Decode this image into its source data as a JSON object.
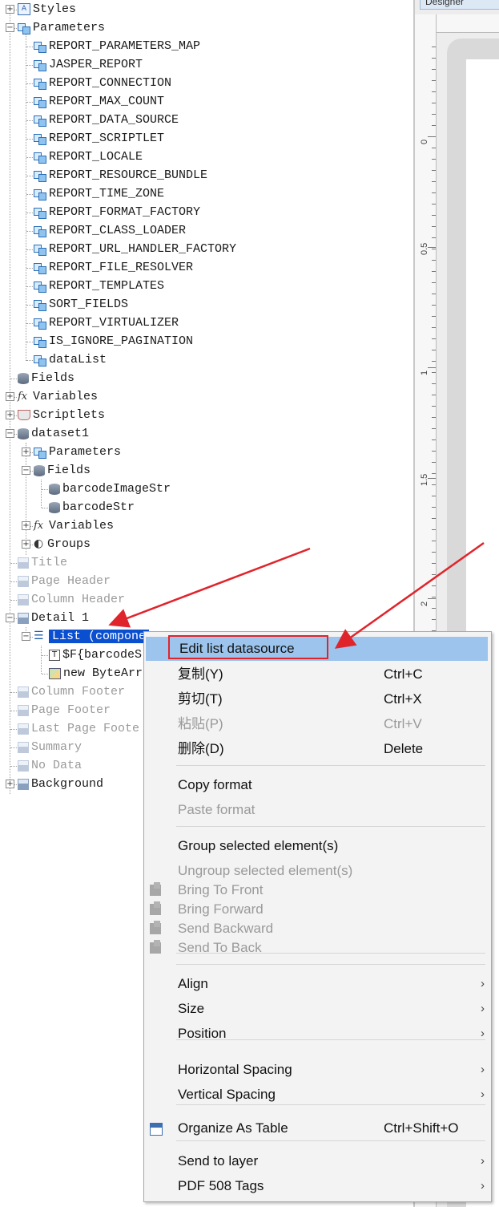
{
  "tree": {
    "items": [
      {
        "key": "styles",
        "label": "Styles",
        "icon": "styles-icon",
        "disabled": false
      },
      {
        "key": "parameters",
        "label": "Parameters",
        "icon": "parameter-icon",
        "disabled": false
      },
      {
        "key": "p1",
        "label": "REPORT_PARAMETERS_MAP",
        "icon": "parameter-icon",
        "disabled": false
      },
      {
        "key": "p2",
        "label": "JASPER_REPORT",
        "icon": "parameter-icon",
        "disabled": false
      },
      {
        "key": "p3",
        "label": "REPORT_CONNECTION",
        "icon": "parameter-icon",
        "disabled": false
      },
      {
        "key": "p4",
        "label": "REPORT_MAX_COUNT",
        "icon": "parameter-icon",
        "disabled": false
      },
      {
        "key": "p5",
        "label": "REPORT_DATA_SOURCE",
        "icon": "parameter-icon",
        "disabled": false
      },
      {
        "key": "p6",
        "label": "REPORT_SCRIPTLET",
        "icon": "parameter-icon",
        "disabled": false
      },
      {
        "key": "p7",
        "label": "REPORT_LOCALE",
        "icon": "parameter-icon",
        "disabled": false
      },
      {
        "key": "p8",
        "label": "REPORT_RESOURCE_BUNDLE",
        "icon": "parameter-icon",
        "disabled": false
      },
      {
        "key": "p9",
        "label": "REPORT_TIME_ZONE",
        "icon": "parameter-icon",
        "disabled": false
      },
      {
        "key": "p10",
        "label": "REPORT_FORMAT_FACTORY",
        "icon": "parameter-icon",
        "disabled": false
      },
      {
        "key": "p11",
        "label": "REPORT_CLASS_LOADER",
        "icon": "parameter-icon",
        "disabled": false
      },
      {
        "key": "p12",
        "label": "REPORT_URL_HANDLER_FACTORY",
        "icon": "parameter-icon",
        "disabled": false
      },
      {
        "key": "p13",
        "label": "REPORT_FILE_RESOLVER",
        "icon": "parameter-icon",
        "disabled": false
      },
      {
        "key": "p14",
        "label": "REPORT_TEMPLATES",
        "icon": "parameter-icon",
        "disabled": false
      },
      {
        "key": "p15",
        "label": "SORT_FIELDS",
        "icon": "parameter-icon",
        "disabled": false
      },
      {
        "key": "p16",
        "label": "REPORT_VIRTUALIZER",
        "icon": "parameter-icon",
        "disabled": false
      },
      {
        "key": "p17",
        "label": "IS_IGNORE_PAGINATION",
        "icon": "parameter-icon",
        "disabled": false
      },
      {
        "key": "p18",
        "label": "dataList",
        "icon": "parameter-icon",
        "disabled": false
      },
      {
        "key": "fields",
        "label": "Fields",
        "icon": "database-icon",
        "disabled": false
      },
      {
        "key": "variables",
        "label": "Variables",
        "icon": "fx-icon",
        "disabled": false
      },
      {
        "key": "scriptlets",
        "label": "Scriptlets",
        "icon": "coffee-icon",
        "disabled": false
      },
      {
        "key": "dataset1",
        "label": "dataset1",
        "icon": "database-icon",
        "disabled": false
      },
      {
        "key": "ds_params",
        "label": "Parameters",
        "icon": "parameter-icon",
        "disabled": false
      },
      {
        "key": "ds_fields",
        "label": "Fields",
        "icon": "database-icon",
        "disabled": false
      },
      {
        "key": "f1",
        "label": "barcodeImageStr",
        "icon": "database-icon",
        "disabled": false
      },
      {
        "key": "f2",
        "label": "barcodeStr",
        "icon": "database-icon",
        "disabled": false
      },
      {
        "key": "ds_vars",
        "label": "Variables",
        "icon": "fx-icon",
        "disabled": false
      },
      {
        "key": "ds_groups",
        "label": "Groups",
        "icon": "groups-icon",
        "disabled": false
      },
      {
        "key": "title",
        "label": "Title",
        "icon": "band-icon",
        "disabled": true
      },
      {
        "key": "page_header",
        "label": "Page Header",
        "icon": "band-icon",
        "disabled": true
      },
      {
        "key": "column_header",
        "label": "Column Header",
        "icon": "band-icon",
        "disabled": true
      },
      {
        "key": "detail1",
        "label": "Detail 1",
        "icon": "band-icon",
        "disabled": false
      },
      {
        "key": "list",
        "label": "List (compone",
        "icon": "list-icon",
        "disabled": false
      },
      {
        "key": "tf",
        "label": "$F{barcodeS",
        "icon": "text-field-icon",
        "disabled": false
      },
      {
        "key": "img",
        "label": "new ByteArr",
        "icon": "image-icon",
        "disabled": false
      },
      {
        "key": "column_footer",
        "label": "Column Footer",
        "icon": "band-icon",
        "disabled": true
      },
      {
        "key": "page_footer",
        "label": "Page Footer",
        "icon": "band-icon",
        "disabled": true
      },
      {
        "key": "last_page_footer",
        "label": "Last Page Foote",
        "icon": "band-icon",
        "disabled": true
      },
      {
        "key": "summary",
        "label": "Summary",
        "icon": "band-icon",
        "disabled": true
      },
      {
        "key": "no_data",
        "label": "No Data",
        "icon": "band-icon",
        "disabled": true
      },
      {
        "key": "background",
        "label": "Background",
        "icon": "band-icon",
        "disabled": false
      }
    ]
  },
  "designer": {
    "tab_label": "Designer",
    "ruler_labels": [
      "0",
      "0.5",
      "1",
      "1.5",
      "2"
    ]
  },
  "context_menu": {
    "items": [
      {
        "label": "Edit list datasource",
        "shortcut": "",
        "disabled": false,
        "submenu": false,
        "icon": ""
      },
      {
        "label": "复制(Y)",
        "shortcut": "Ctrl+C",
        "disabled": false,
        "submenu": false,
        "icon": ""
      },
      {
        "label": "剪切(T)",
        "shortcut": "Ctrl+X",
        "disabled": false,
        "submenu": false,
        "icon": ""
      },
      {
        "label": "粘贴(P)",
        "shortcut": "Ctrl+V",
        "disabled": true,
        "submenu": false,
        "icon": ""
      },
      {
        "label": "删除(D)",
        "shortcut": "Delete",
        "disabled": false,
        "submenu": false,
        "icon": ""
      },
      {
        "label": "Copy format",
        "shortcut": "",
        "disabled": false,
        "submenu": false,
        "icon": ""
      },
      {
        "label": "Paste format",
        "shortcut": "",
        "disabled": true,
        "submenu": false,
        "icon": ""
      },
      {
        "label": "Group selected element(s)",
        "shortcut": "",
        "disabled": false,
        "submenu": false,
        "icon": ""
      },
      {
        "label": "Ungroup selected element(s)",
        "shortcut": "",
        "disabled": true,
        "submenu": false,
        "icon": ""
      },
      {
        "label": "Bring To Front",
        "shortcut": "",
        "disabled": true,
        "submenu": false,
        "icon": "bring-to-front-icon"
      },
      {
        "label": "Bring Forward",
        "shortcut": "",
        "disabled": true,
        "submenu": false,
        "icon": "bring-forward-icon"
      },
      {
        "label": "Send Backward",
        "shortcut": "",
        "disabled": true,
        "submenu": false,
        "icon": "send-backward-icon"
      },
      {
        "label": "Send To Back",
        "shortcut": "",
        "disabled": true,
        "submenu": false,
        "icon": "send-to-back-icon"
      },
      {
        "label": "Align",
        "shortcut": "",
        "disabled": false,
        "submenu": true,
        "icon": ""
      },
      {
        "label": "Size",
        "shortcut": "",
        "disabled": false,
        "submenu": true,
        "icon": ""
      },
      {
        "label": "Position",
        "shortcut": "",
        "disabled": false,
        "submenu": true,
        "icon": ""
      },
      {
        "label": "Horizontal Spacing",
        "shortcut": "",
        "disabled": false,
        "submenu": true,
        "icon": ""
      },
      {
        "label": "Vertical Spacing",
        "shortcut": "",
        "disabled": false,
        "submenu": true,
        "icon": ""
      },
      {
        "label": "Organize As Table",
        "shortcut": "Ctrl+Shift+O",
        "disabled": false,
        "submenu": false,
        "icon": "table-icon"
      },
      {
        "label": "Send to layer",
        "shortcut": "",
        "disabled": false,
        "submenu": true,
        "icon": ""
      },
      {
        "label": "PDF 508 Tags",
        "shortcut": "",
        "disabled": false,
        "submenu": true,
        "icon": ""
      }
    ]
  },
  "colors": {
    "selection": "#0a4fd0",
    "menu_highlight": "#9cc4ec",
    "annotation_red": "#e0242c"
  }
}
